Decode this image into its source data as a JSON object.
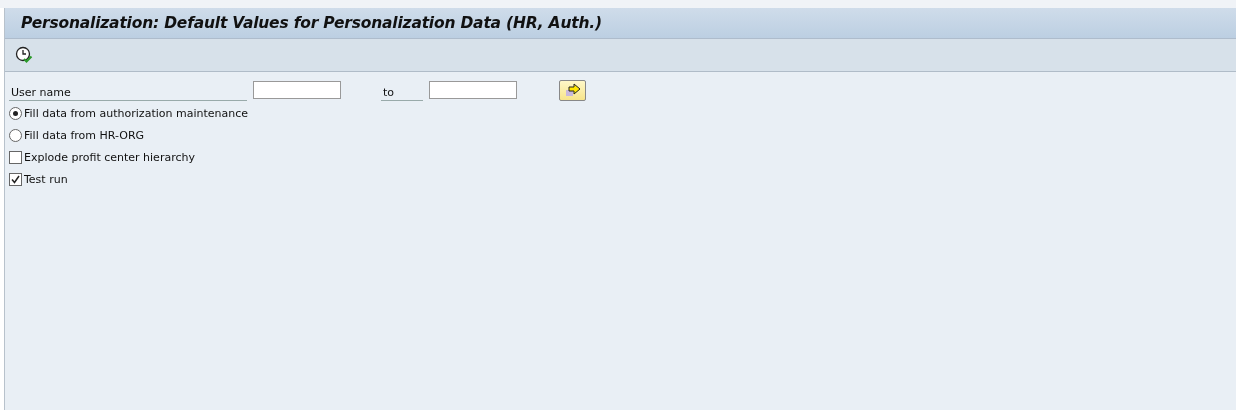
{
  "window": {
    "title": "Personalization: Default Values for Personalization Data (HR, Auth.)"
  },
  "selection": {
    "label": "User name",
    "to_label": "to"
  },
  "options": [
    {
      "kind": "radio",
      "label": "Fill data from authorization maintenance",
      "selected": true
    },
    {
      "kind": "radio",
      "label": "Fill data from HR-ORG",
      "selected": false
    },
    {
      "kind": "checkbox",
      "label": "Explode profit center hierarchy",
      "checked": false
    },
    {
      "kind": "checkbox",
      "label": "Test run",
      "checked": true
    }
  ]
}
